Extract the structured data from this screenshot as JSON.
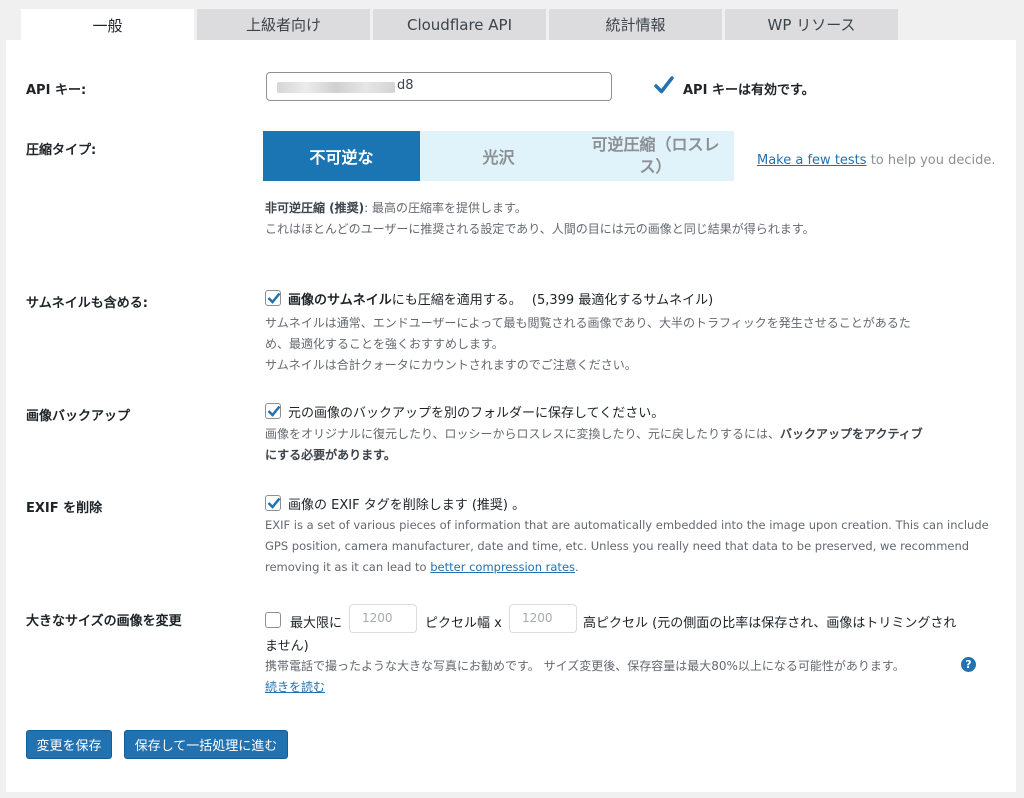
{
  "tabs": [
    "一般",
    "上級者向け",
    "Cloudflare API",
    "統計情報",
    "WP リソース"
  ],
  "api_key": {
    "label": "API キー:",
    "value_suffix": "d8",
    "valid_text": "API キーは有効です。"
  },
  "compression": {
    "label": "圧縮タイプ:",
    "options": [
      "不可逆な",
      "光沢",
      "可逆圧縮（ロスレス）"
    ],
    "selected": "不可逆な",
    "test_link": "Make a few tests",
    "test_suffix": " to help you decide.",
    "desc_bold": "非可逆圧縮 (推奨)",
    "desc_line1_rest": ": 最高の圧縮率を提供します。",
    "desc_line2": "これはほとんどのユーザーに推奨される設定であり、人間の目には元の画像と同じ結果が得られます。"
  },
  "thumbnails": {
    "label": "サムネイルも含める:",
    "checked": true,
    "check_bold": "画像のサムネイル",
    "check_rest": "にも圧縮を適用する。",
    "count_text": "(5,399 最適化するサムネイル)",
    "desc_line1": "サムネイルは通常、エンドユーザーによって最も閲覧される画像であり、大半のトラフィックを発生させることがあるた",
    "desc_line2": "め、最適化することを強くおすすめします。",
    "desc_line3": "サムネイルは合計クォータにカウントされますのでご注意ください。"
  },
  "backup": {
    "label": "画像バックアップ",
    "checked": true,
    "check_text": "元の画像のバックアップを別のフォルダーに保存してください。",
    "desc_line1_a": "画像をオリジナルに復元したり、ロッシーからロスレスに変換したり、元に戻したりするには、",
    "desc_line1_bold": "バックアップをアクティブ",
    "desc_line2_bold": "にする必要があります。"
  },
  "exif": {
    "label": "EXIF を削除",
    "checked": true,
    "check_text": "画像の EXIF タグを削除します (推奨) 。",
    "desc_line1": "EXIF is a set of various pieces of information that are automatically embedded into the image upon creation. This can include",
    "desc_line2": "GPS position, camera manufacturer, date and time, etc. Unless you really need that data to be preserved, we recommend",
    "desc_line3_a": "removing it as it can lead to ",
    "desc_link": "better compression rates",
    "desc_line3_end": "."
  },
  "resize": {
    "label": "大きなサイズの画像を変更",
    "checked": false,
    "max_text": "最大限に",
    "width_placeholder": "1200",
    "width_unit": "ピクセル幅 x",
    "height_placeholder": "1200",
    "height_unit": "高ピクセル (元の側面の比率は保存され、画像はトリミングされ",
    "wrap_text": "ません)",
    "desc_line1": "携帯電話で撮ったような大きな写真にお勧めです。 サイズ変更後、保存容量は最大80%以上になる可能性があります。",
    "help_icon": "?",
    "read_more": "続きを読む"
  },
  "buttons": {
    "save": "変更を保存",
    "save_bulk": "保存して一括処理に進む"
  },
  "colors": {
    "accent": "#2271b1",
    "selected_option": "#1c75b3",
    "unselected_option": "#e0f3fa"
  }
}
